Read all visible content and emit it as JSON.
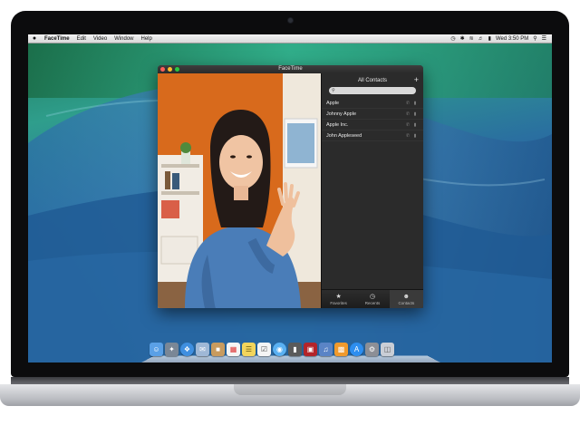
{
  "menubar": {
    "apple": "",
    "app_name": "FaceTime",
    "menus": [
      "Edit",
      "Video",
      "Window",
      "Help"
    ],
    "clock": "Wed 3:50 PM"
  },
  "window": {
    "title": "FaceTime"
  },
  "contacts_panel": {
    "header": "All Contacts",
    "add_label": "+",
    "search_placeholder": "",
    "contacts": [
      {
        "name": "Apple"
      },
      {
        "name": "Johnny Apple"
      },
      {
        "name": "Apple Inc."
      },
      {
        "name": "John Appleseed"
      }
    ],
    "tabs": [
      {
        "label": "Favorites",
        "icon": "star-icon"
      },
      {
        "label": "Recents",
        "icon": "clock-icon"
      },
      {
        "label": "Contacts",
        "icon": "person-icon",
        "active": true
      }
    ]
  },
  "dock_items": [
    "finder-icon",
    "launchpad-icon",
    "safari-icon",
    "mail-icon",
    "contacts-icon",
    "calendar-icon",
    "notes-icon",
    "reminders-icon",
    "messages-icon",
    "facetime-icon",
    "photo-booth-icon",
    "itunes-icon",
    "ibooks-icon",
    "app-store-icon",
    "system-preferences-icon",
    "trash-icon"
  ],
  "colors": {
    "close": "#fc5f57",
    "minimize": "#fdbc2d",
    "zoom": "#29c841",
    "wall_accent": "#29c39a"
  }
}
